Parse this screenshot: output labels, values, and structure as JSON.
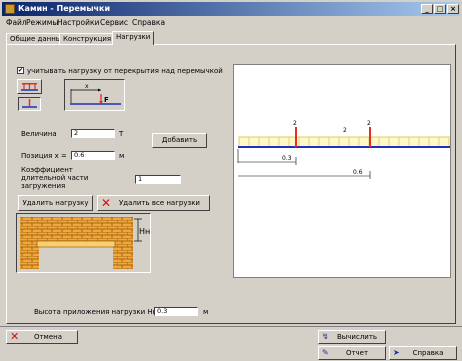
{
  "window": {
    "title": "Камин - Перемычки"
  },
  "menu": {
    "items": [
      "Файл",
      "Режимы",
      "Настройки",
      "Сервис",
      "Справка"
    ]
  },
  "tabs": [
    "Общие данные",
    "Конструкция",
    "Нагрузки"
  ],
  "loads": {
    "checkbox_label": "учитывать нагрузку от перекрытия над перемычкой",
    "checkbox_checked": true,
    "magnitude_label": "Величина",
    "magnitude_value": "2",
    "magnitude_unit": "Т",
    "position_label": "Позиция x =",
    "position_value": "0.6",
    "position_unit": "м",
    "coef_label": "Коэффициент длительной части загружения",
    "coef_value": "1",
    "add_button": "Добавить",
    "delete_button": "Удалить нагрузку",
    "delete_all_button": "Удалить все нагрузки",
    "icon_diagram_labels": {
      "x": "x",
      "f": "F"
    },
    "wall_label": "Hн",
    "height_label": "Высота приложения нагрузки Hн",
    "height_value": "0.3",
    "height_unit": "м"
  },
  "diagram": {
    "load_labels": [
      "2",
      "2",
      "2"
    ],
    "dim1": "0.3",
    "dim2": "0.6"
  },
  "footer": {
    "cancel_button": "Отмена",
    "calculate_button": "Вычислить",
    "report_button": "Отчет",
    "help_button": "Справка"
  }
}
